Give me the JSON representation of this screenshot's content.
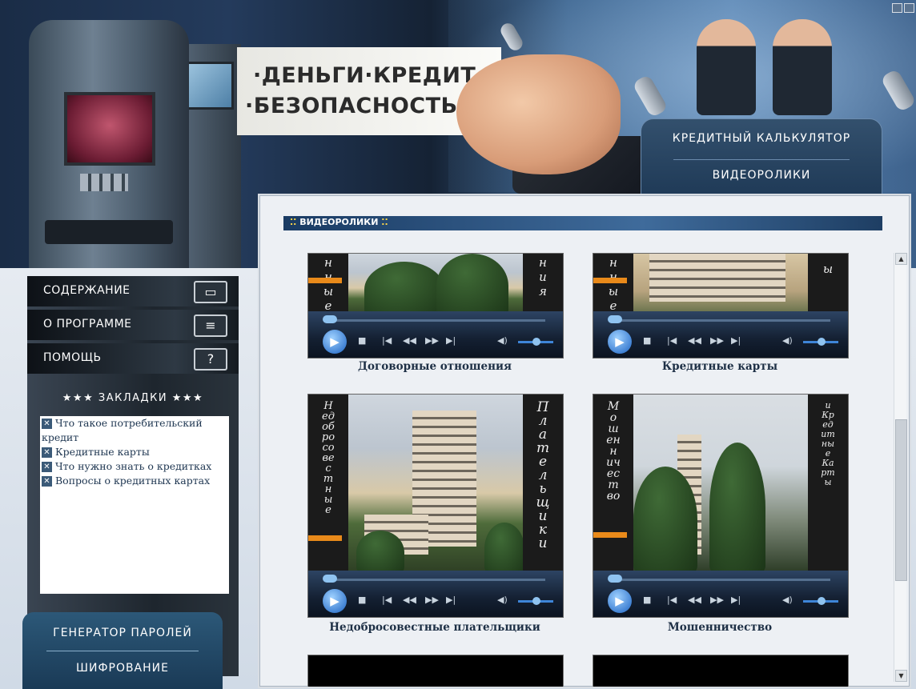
{
  "banner": {
    "slogan_line1": "·ДЕНЬГИ·КРЕДИТ·",
    "slogan_line2": "·БЕЗОПАСНОСТЬ·"
  },
  "top_menu": {
    "item1": "КРЕДИТНЫЙ КАЛЬКУЛЯТОР",
    "item2": "ВИДЕОРОЛИКИ"
  },
  "left_nav": {
    "items": [
      {
        "label": "СОДЕРЖАНИЕ",
        "icon": "folder-icon"
      },
      {
        "label": "О ПРОГРАММЕ",
        "icon": "info-card-icon"
      },
      {
        "label": "ПОМОЩЬ",
        "icon": "help-icon",
        "glyph": "?"
      }
    ]
  },
  "bookmarks": {
    "title": "★★★ ЗАКЛАДКИ ★★★",
    "items": [
      "Что такое потребительский кредит",
      "Кредитные карты",
      "Что нужно знать о кредитках",
      "Вопросы о кредитных картах"
    ]
  },
  "bottom_nav": {
    "item1": "ГЕНЕРАТОР ПАРОЛЕЙ",
    "item2": "ШИФРОВАНИЕ"
  },
  "panel": {
    "title": "ВИДЕОРОЛИКИ",
    "videos": [
      {
        "caption": "Договорные отношения",
        "left_text": "нные",
        "right_text": "ния"
      },
      {
        "caption": "Кредитные карты",
        "left_text": "нные",
        "right_text": "ы"
      },
      {
        "caption": "Недобросовестные плательщики",
        "left_text": "Недобросовестные",
        "right_text": "Плательщики"
      },
      {
        "caption": "Мошенничество",
        "left_text": "Мошенничество",
        "right_text": "и Кредитные Карты"
      }
    ]
  },
  "player": {
    "play_glyph": "▶",
    "stop_glyph": "■",
    "prev_glyph": "|◀",
    "rew_glyph": "◀◀",
    "fwd_glyph": "▶▶",
    "next_glyph": "▶|",
    "volume_glyph": "◀)"
  }
}
